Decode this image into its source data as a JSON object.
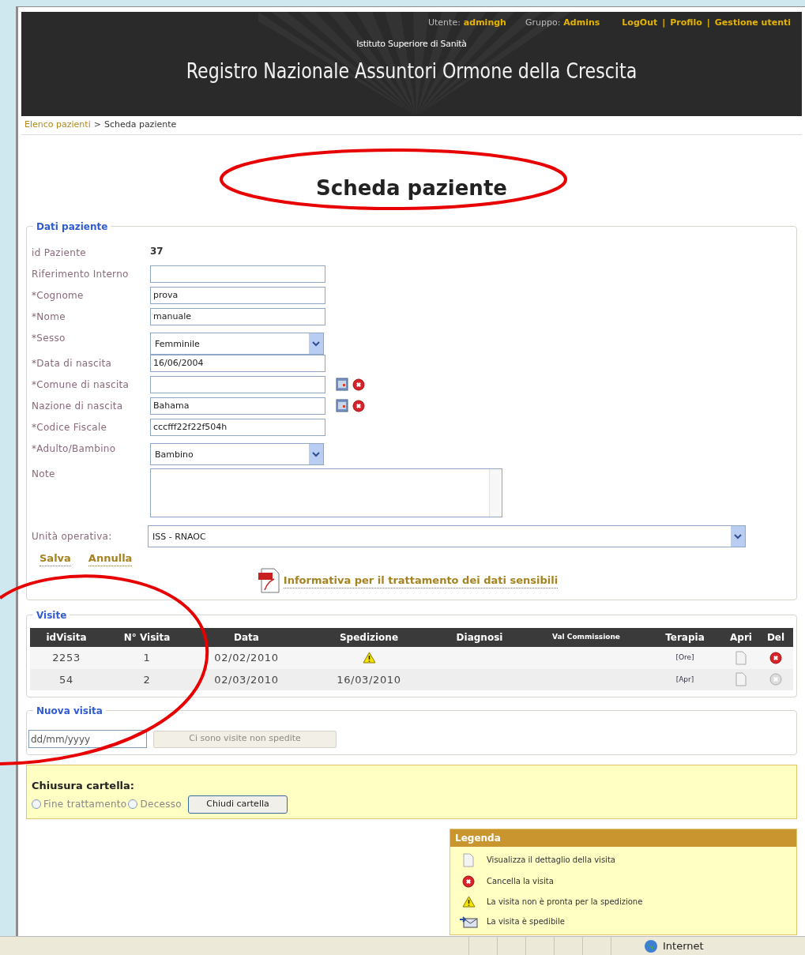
{
  "header": {
    "user_label": "Utente:",
    "user": "admingh",
    "group_label": "Gruppo:",
    "group": "Admins",
    "links": [
      "LogOut",
      "Profilo",
      "Gestione utenti"
    ],
    "separator": "|",
    "institute": "Istituto Superiore di Sanità",
    "title": "Registro Nazionale Assuntori Ormone della Crescita"
  },
  "breadcrumb": {
    "items": [
      "Elenco pazienti",
      "Scheda paziente"
    ],
    "separator": ">"
  },
  "page_title": "Scheda paziente",
  "patient": {
    "legend": "Dati paziente",
    "fields": [
      {
        "kind": "static",
        "label": "id Paziente",
        "value": "37"
      },
      {
        "kind": "input",
        "label": "Riferimento Interno"
      },
      {
        "kind": "input",
        "label": "*Cognome",
        "value": "prova"
      },
      {
        "kind": "input",
        "label": "*Nome",
        "value": "manuale"
      },
      {
        "kind": "select",
        "label": "*Sesso",
        "value": "Femminile"
      },
      {
        "kind": "input",
        "label": "*Data di nascita",
        "value": "16/06/2004"
      },
      {
        "kind": "lookup",
        "label": "*Comune di nascita"
      },
      {
        "kind": "lookup",
        "label": "Nazione di nascita",
        "value": "Bahama"
      },
      {
        "kind": "input",
        "label": "*Codice Fiscale",
        "value": "cccfff22f22f504h"
      },
      {
        "kind": "select",
        "label": "*Adulto/Bambino",
        "value": "Bambino"
      },
      {
        "kind": "textarea",
        "label": "Note"
      }
    ],
    "unit": {
      "label": "Unità operativa:",
      "value": "ISS - RNAOC"
    },
    "actions": [
      "Salva",
      "Annulla"
    ],
    "pdf_link": "Informativa per il trattamento dei dati sensibili"
  },
  "visits": {
    "legend": "Visite",
    "columns": [
      "idVisita",
      "N° Visita",
      "Data",
      "Spedizione",
      "Diagnosi",
      "Val Commissione",
      "Terapia",
      "Apri",
      "Del"
    ],
    "rows": [
      {
        "id": "2253",
        "number": "1",
        "date": "02/02/2010",
        "shipping": {
          "kind": "warning"
        },
        "therapy": "[Ore]",
        "deletable": true
      },
      {
        "id": "54",
        "number": "2",
        "date": "02/03/2010",
        "shipping": {
          "kind": "date",
          "value": "16/03/2010"
        },
        "therapy": "[Apr]",
        "deletable": false
      }
    ]
  },
  "new_visit": {
    "legend": "Nuova visita",
    "placeholder": "dd/mm/yyyy",
    "button": {
      "label": "Ci sono visite non spedite",
      "disabled": true
    }
  },
  "closure": {
    "title": "Chiusura cartella:",
    "options": [
      {
        "label": "Fine trattamento",
        "selected": false
      },
      {
        "label": "Decesso",
        "selected": false
      }
    ],
    "button": "Chiudi cartella"
  },
  "legend_box": {
    "title": "Legenda",
    "items": [
      {
        "kind": "document",
        "text": "Visualizza il dettaglio della visita"
      },
      {
        "kind": "delete",
        "text": "Cancella la visita"
      },
      {
        "kind": "warning",
        "text": "La visita non è pronta per la spedizione"
      },
      {
        "kind": "send",
        "text": "La visita è spedibile"
      }
    ]
  },
  "status_bar": {
    "zone": "Internet"
  }
}
